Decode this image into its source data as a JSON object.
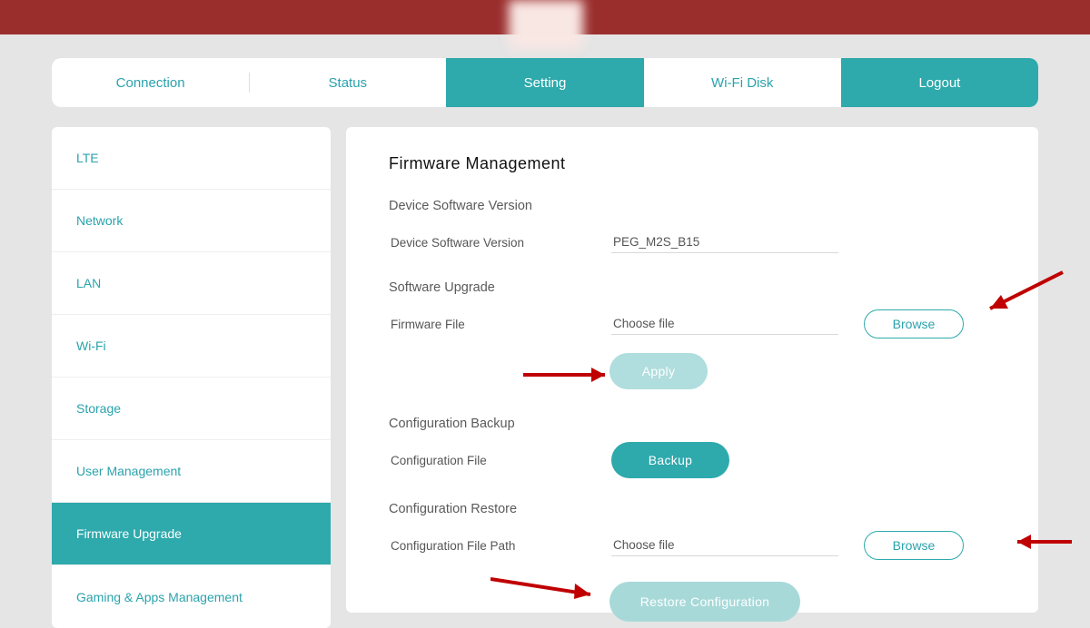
{
  "topnav": {
    "items": [
      {
        "label": "Connection",
        "active": false
      },
      {
        "label": "Status",
        "active": false
      },
      {
        "label": "Setting",
        "active": true
      },
      {
        "label": "Wi-Fi Disk",
        "active": false
      },
      {
        "label": "Logout",
        "active": true
      }
    ]
  },
  "sidebar": {
    "items": [
      {
        "label": "LTE",
        "active": false
      },
      {
        "label": "Network",
        "active": false
      },
      {
        "label": "LAN",
        "active": false
      },
      {
        "label": "Wi-Fi",
        "active": false
      },
      {
        "label": "Storage",
        "active": false
      },
      {
        "label": "User Management",
        "active": false
      },
      {
        "label": "Firmware Upgrade",
        "active": true
      },
      {
        "label": "Gaming & Apps Management",
        "active": false
      }
    ]
  },
  "main": {
    "title": "Firmware Management",
    "device_version": {
      "heading": "Device Software Version",
      "label": "Device Software Version",
      "value": "PEG_M2S_B15"
    },
    "software_upgrade": {
      "heading": "Software Upgrade",
      "file_label": "Firmware File",
      "file_placeholder": "Choose file",
      "browse": "Browse",
      "apply": "Apply"
    },
    "config_backup": {
      "heading": "Configuration Backup",
      "label": "Configuration File",
      "backup": "Backup"
    },
    "config_restore": {
      "heading": "Configuration Restore",
      "label": "Configuration File Path",
      "file_placeholder": "Choose file",
      "browse": "Browse",
      "restore": "Restore Configuration"
    }
  }
}
